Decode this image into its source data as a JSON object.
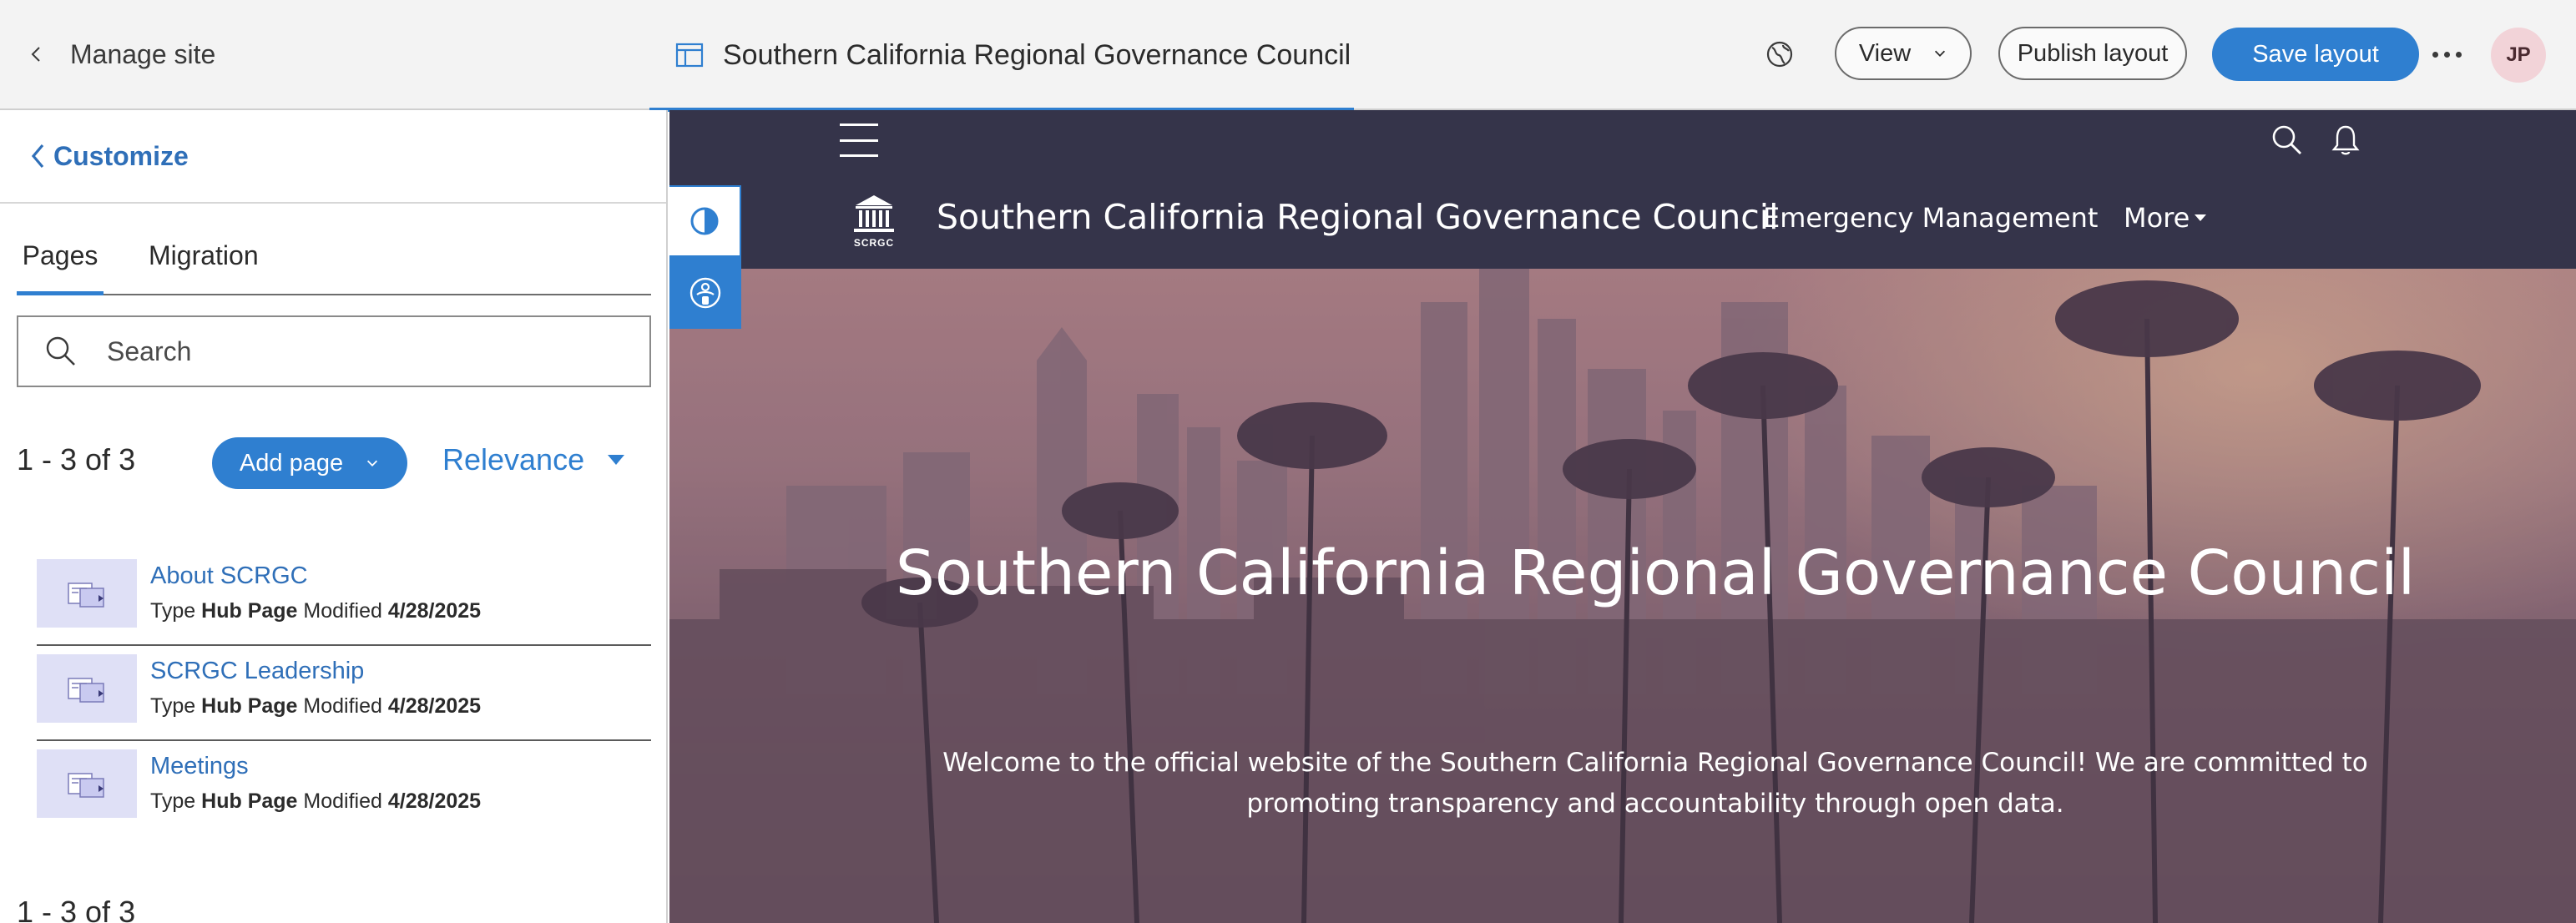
{
  "header": {
    "back_label": "Manage site",
    "site_tab_title": "Southern California Regional Governance Council",
    "view_label": "View",
    "publish_label": "Publish layout",
    "save_label": "Save layout",
    "avatar_initials": "JP"
  },
  "panel": {
    "customize_label": "Customize",
    "tabs": [
      {
        "label": "Pages",
        "active": true
      },
      {
        "label": "Migration",
        "active": false
      }
    ],
    "search_placeholder": "Search",
    "count_text": "1 - 3 of 3",
    "add_page_label": "Add page",
    "sort_label": "Relevance",
    "type_label": "Type",
    "modified_label": "Modified",
    "pages": [
      {
        "title": "About SCRGC",
        "type": "Hub Page",
        "modified": "4/28/2025"
      },
      {
        "title": "SCRGC Leadership",
        "type": "Hub Page",
        "modified": "4/28/2025"
      },
      {
        "title": "Meetings",
        "type": "Hub Page",
        "modified": "4/28/2025"
      }
    ],
    "count_text_bottom": "1 - 3 of 3"
  },
  "preview": {
    "logo_text": "SCRGC",
    "site_name": "Southern California Regional Governance Council",
    "nav_links": [
      "Emergency Management",
      "More"
    ],
    "hero_title": "Southern California Regional Governance Council",
    "hero_subtitle": "Welcome to the official website of the Southern California Regional Governance Council! We are committed to promoting transparency and accountability through open data."
  },
  "colors": {
    "accent": "#2f7fd0",
    "nav_background": "#35344a",
    "avatar_background": "#f2d3d8"
  }
}
